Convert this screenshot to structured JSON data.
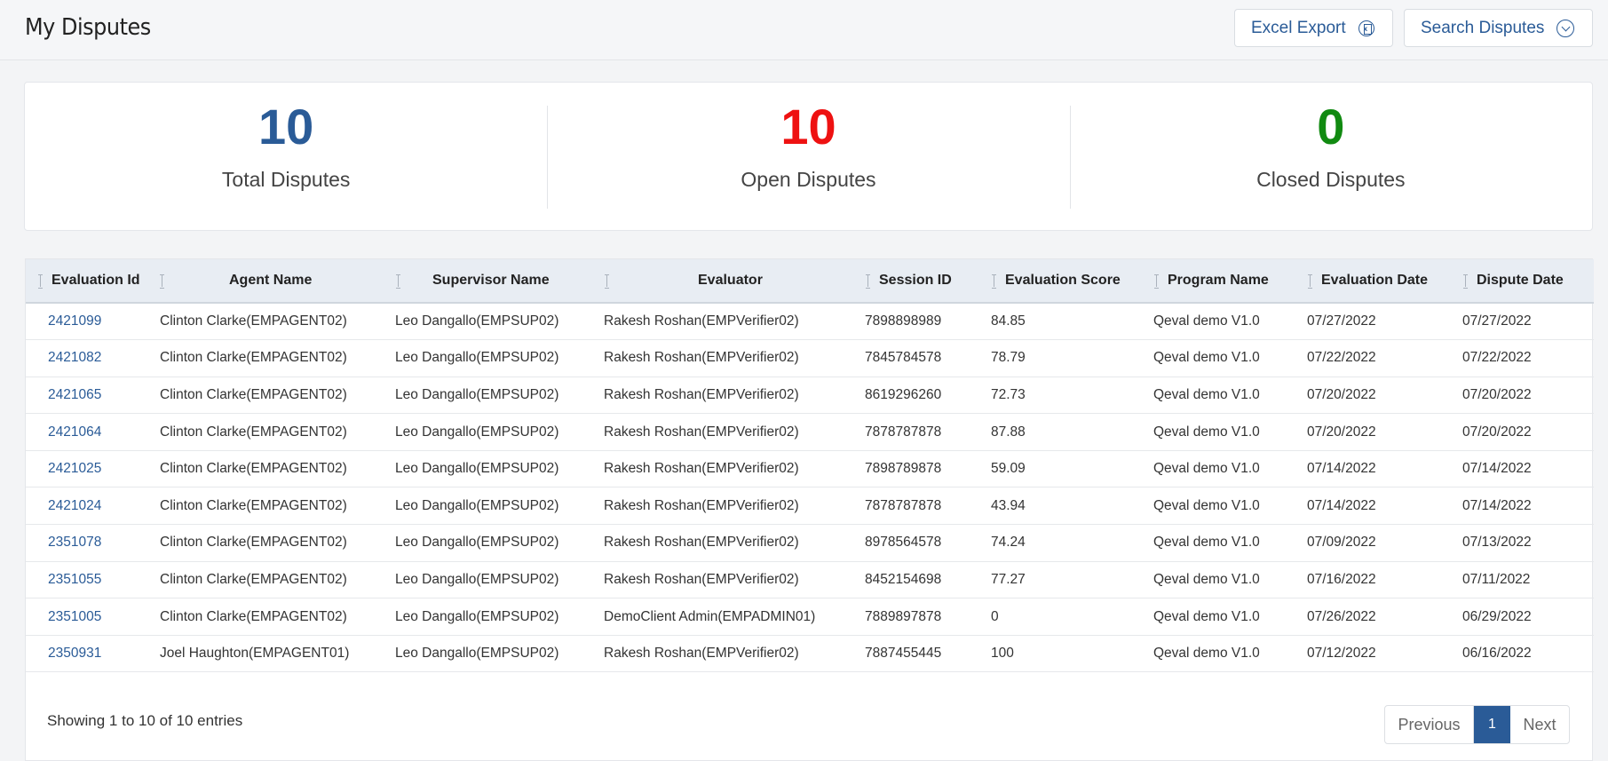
{
  "header": {
    "title": "My Disputes",
    "excel_export_label": "Excel Export",
    "search_label": "Search Disputes"
  },
  "stats": [
    {
      "value": "10",
      "label": "Total Disputes",
      "color": "#2a5b97"
    },
    {
      "value": "10",
      "label": "Open Disputes",
      "color": "#ee1111"
    },
    {
      "value": "0",
      "label": "Closed Disputes",
      "color": "#118a11"
    }
  ],
  "table": {
    "columns": [
      "Evaluation Id",
      "Agent Name",
      "Supervisor Name",
      "Evaluator",
      "Session ID",
      "Evaluation Score",
      "Program Name",
      "Evaluation Date",
      "Dispute Date"
    ],
    "rows": [
      [
        "2421099",
        "Clinton Clarke(EMPAGENT02)",
        "Leo Dangallo(EMPSUP02)",
        "Rakesh Roshan(EMPVerifier02)",
        "7898898989",
        "84.85",
        "Qeval demo V1.0",
        "07/27/2022",
        "07/27/2022"
      ],
      [
        "2421082",
        "Clinton Clarke(EMPAGENT02)",
        "Leo Dangallo(EMPSUP02)",
        "Rakesh Roshan(EMPVerifier02)",
        "7845784578",
        "78.79",
        "Qeval demo V1.0",
        "07/22/2022",
        "07/22/2022"
      ],
      [
        "2421065",
        "Clinton Clarke(EMPAGENT02)",
        "Leo Dangallo(EMPSUP02)",
        "Rakesh Roshan(EMPVerifier02)",
        "8619296260",
        "72.73",
        "Qeval demo V1.0",
        "07/20/2022",
        "07/20/2022"
      ],
      [
        "2421064",
        "Clinton Clarke(EMPAGENT02)",
        "Leo Dangallo(EMPSUP02)",
        "Rakesh Roshan(EMPVerifier02)",
        "7878787878",
        "87.88",
        "Qeval demo V1.0",
        "07/20/2022",
        "07/20/2022"
      ],
      [
        "2421025",
        "Clinton Clarke(EMPAGENT02)",
        "Leo Dangallo(EMPSUP02)",
        "Rakesh Roshan(EMPVerifier02)",
        "7898789878",
        "59.09",
        "Qeval demo V1.0",
        "07/14/2022",
        "07/14/2022"
      ],
      [
        "2421024",
        "Clinton Clarke(EMPAGENT02)",
        "Leo Dangallo(EMPSUP02)",
        "Rakesh Roshan(EMPVerifier02)",
        "7878787878",
        "43.94",
        "Qeval demo V1.0",
        "07/14/2022",
        "07/14/2022"
      ],
      [
        "2351078",
        "Clinton Clarke(EMPAGENT02)",
        "Leo Dangallo(EMPSUP02)",
        "Rakesh Roshan(EMPVerifier02)",
        "8978564578",
        "74.24",
        "Qeval demo V1.0",
        "07/09/2022",
        "07/13/2022"
      ],
      [
        "2351055",
        "Clinton Clarke(EMPAGENT02)",
        "Leo Dangallo(EMPSUP02)",
        "Rakesh Roshan(EMPVerifier02)",
        "8452154698",
        "77.27",
        "Qeval demo V1.0",
        "07/16/2022",
        "07/11/2022"
      ],
      [
        "2351005",
        "Clinton Clarke(EMPAGENT02)",
        "Leo Dangallo(EMPSUP02)",
        "DemoClient Admin(EMPADMIN01)",
        "7889897878",
        "0",
        "Qeval demo V1.0",
        "07/26/2022",
        "06/29/2022"
      ],
      [
        "2350931",
        "Joel Haughton(EMPAGENT01)",
        "Leo Dangallo(EMPSUP02)",
        "Rakesh Roshan(EMPVerifier02)",
        "7887455445",
        "100",
        "Qeval demo V1.0",
        "07/12/2022",
        "06/16/2022"
      ]
    ]
  },
  "footer": {
    "entries_text": "Showing 1 to 10 of 10 entries",
    "previous_label": "Previous",
    "current_page": "1",
    "next_label": "Next"
  }
}
